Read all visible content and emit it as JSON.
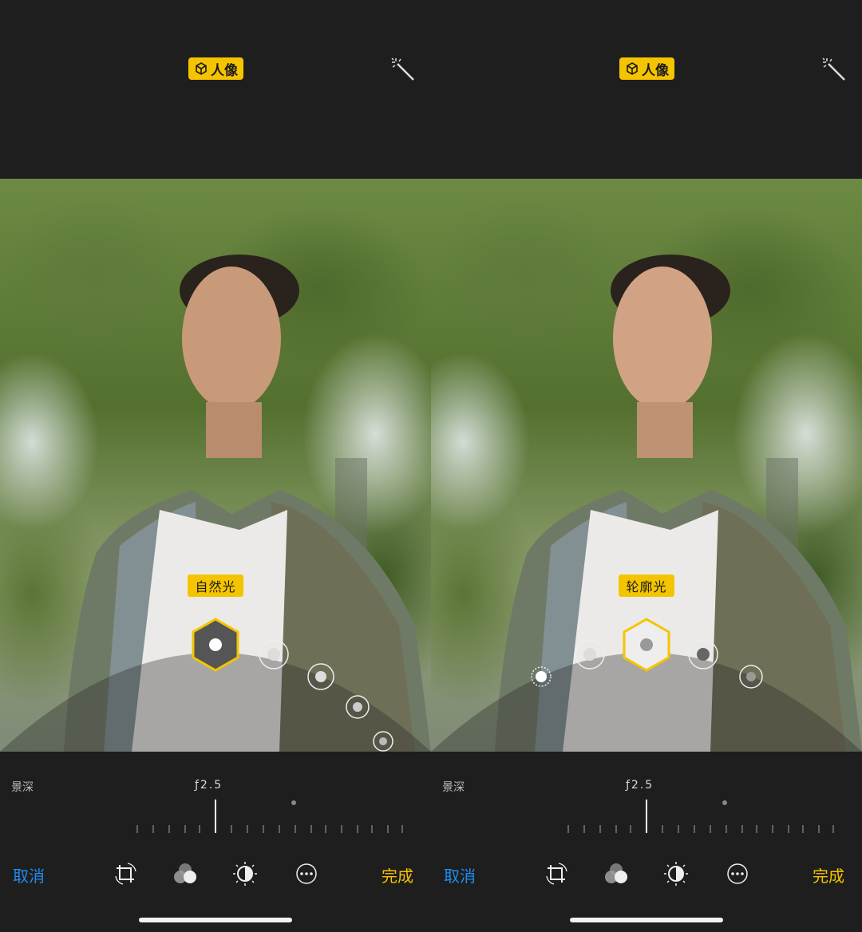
{
  "panels": [
    {
      "mode_badge": "人像",
      "lighting_label": "自然光",
      "depth_label": "景深",
      "aperture": "ƒ2.5",
      "cancel_label": "取消",
      "done_label": "完成",
      "selected_light": "natural-light"
    },
    {
      "mode_badge": "人像",
      "lighting_label": "轮廓光",
      "depth_label": "景深",
      "aperture": "ƒ2.5",
      "cancel_label": "取消",
      "done_label": "完成",
      "selected_light": "contour-light"
    }
  ],
  "colors": {
    "accent_yellow": "#f5c400",
    "cancel_blue": "#1e8cf0",
    "background": "#1e1e1e"
  },
  "icons": {
    "mode_badge": "cube-icon",
    "auto_enhance": "magic-wand-icon",
    "tools": [
      "crop-rotate-icon",
      "filters-icon",
      "adjust-icon",
      "more-icon"
    ]
  }
}
